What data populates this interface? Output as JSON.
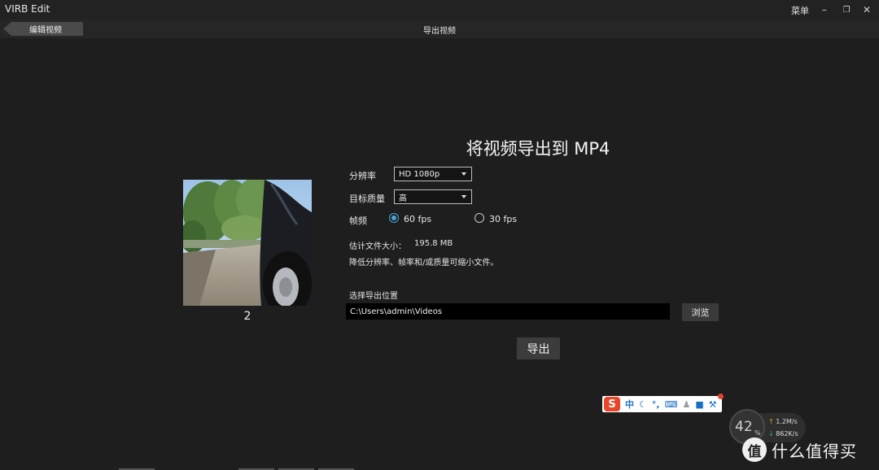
{
  "app": {
    "title": "VIRB Edit",
    "menu_label": "菜单"
  },
  "nav": {
    "back_label": "编辑视频",
    "page_title": "导出视频"
  },
  "clip": {
    "number": "2"
  },
  "export": {
    "heading": "将视频导出到 MP4",
    "resolution_label": "分辨率",
    "resolution_value": "HD 1080p",
    "quality_label": "目标质量",
    "quality_value": "高",
    "framerate_label": "帧频",
    "fps_options": [
      {
        "label": "60 fps",
        "selected": true
      },
      {
        "label": "30 fps",
        "selected": false
      }
    ],
    "estimated_size_label": "估计文件大小：",
    "estimated_size_value": "195.8 MB",
    "size_hint": "降低分辨率、帧率和/或质量可缩小文件。",
    "location_label": "选择导出位置",
    "location_path": "C:\\Users\\admin\\Videos",
    "browse_label": "浏览",
    "export_button_label": "导出"
  },
  "ime": {
    "logo": "S",
    "mode": "中",
    "items": [
      "moon-icon",
      "punctuation-icon",
      "keyboard-icon",
      "person-icon",
      "shirt-icon",
      "wrench-icon"
    ]
  },
  "network": {
    "percent": "42",
    "percent_sign": "%",
    "upload": "1.2",
    "upload_unit": "M/s",
    "download": "862",
    "download_unit": "K/s"
  },
  "watermark": {
    "icon_text": "值",
    "text": "什么值得买"
  },
  "colors": {
    "background": "#1e1e1e",
    "accent": "#4aa8d8",
    "ime_brand": "#e8462b"
  }
}
